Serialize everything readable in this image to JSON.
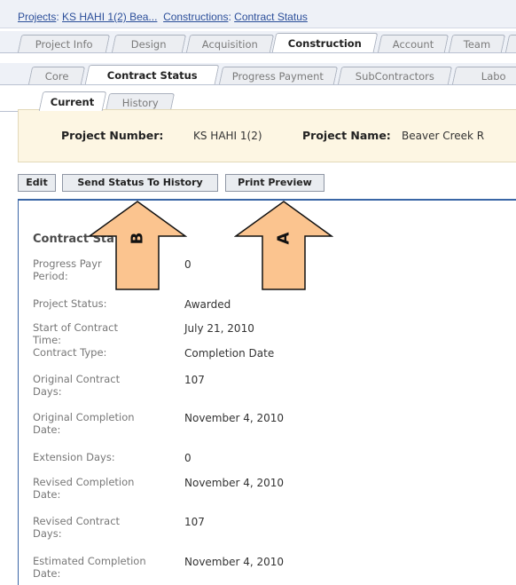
{
  "breadcrumb": {
    "projects_label": "Projects",
    "project_link": "KS HAHI 1(2) Bea...",
    "constructions_label": "Constructions",
    "page_link": "Contract Status",
    "separator": ":"
  },
  "main_tabs": [
    "Project Info",
    "Design",
    "Acquisition",
    "Construction",
    "Account",
    "Team",
    ""
  ],
  "sub_tabs": [
    "Core",
    "Contract Status",
    "Progress Payment",
    "SubContractors",
    "Labo"
  ],
  "status_tabs": [
    "Current",
    "History"
  ],
  "project": {
    "number_label": "Project Number:",
    "number": "KS HAHI 1(2)",
    "name_label": "Project Name:",
    "name": "Beaver Creek R"
  },
  "toolbar": {
    "edit": "Edit",
    "send_status": "Send Status To History",
    "print_preview": "Print Preview"
  },
  "section_title": "Contract Sta",
  "fields": [
    {
      "label": "Progress Payr\nPeriod:",
      "value": "0"
    },
    {
      "label": "Project Status:",
      "value": "Awarded"
    },
    {
      "label": "Start of Contract Time:",
      "value": "July 21, 2010"
    },
    {
      "label": "Contract Type:",
      "value": "Completion Date"
    },
    {
      "label": "Original Contract\nDays:",
      "value": "107"
    },
    {
      "label": "Original Completion\nDate:",
      "value": "November 4, 2010"
    },
    {
      "label": "Extension Days:",
      "value": "0"
    },
    {
      "label": "Revised Completion\nDate:",
      "value": "November 4, 2010"
    },
    {
      "label": "Revised Contract\nDays:",
      "value": "107"
    },
    {
      "label": "Estimated Completion\nDate:",
      "value": "November 4, 2010"
    }
  ],
  "callouts": {
    "b": "B",
    "a": "A",
    "fill": "#fbc48f",
    "stroke": "#111111"
  }
}
